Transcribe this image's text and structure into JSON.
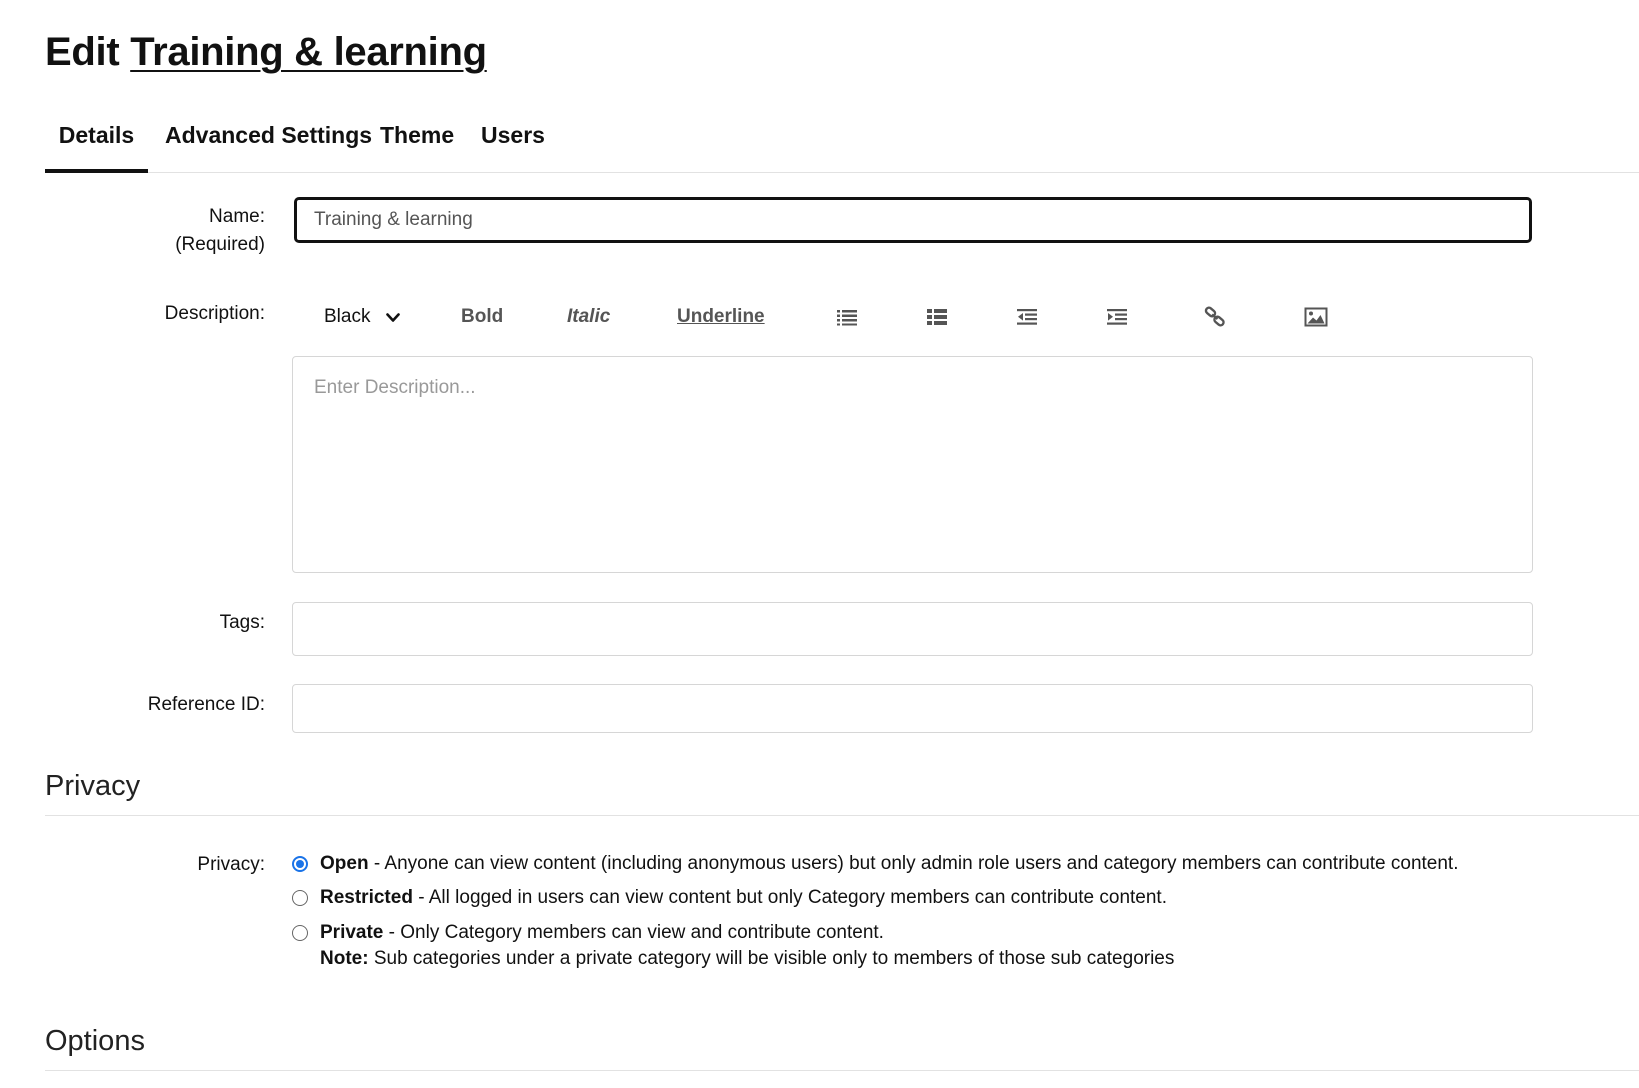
{
  "header": {
    "prefix": "Edit",
    "category_name": "Training & learning"
  },
  "tabs": [
    {
      "label": "Details",
      "active": true
    },
    {
      "label": "Advanced Settings",
      "active": false
    },
    {
      "label": "Theme",
      "active": false
    },
    {
      "label": "Users",
      "active": false
    }
  ],
  "form": {
    "name": {
      "label": "Name:",
      "required_label": "(Required)",
      "value": "Training & learning"
    },
    "description": {
      "label": "Description:",
      "placeholder": "Enter Description...",
      "toolbar": {
        "color": "Black",
        "bold": "Bold",
        "italic": "Italic",
        "underline": "Underline",
        "icons": [
          "bullet-list-icon",
          "numbered-list-icon",
          "outdent-icon",
          "indent-icon",
          "link-icon",
          "image-icon"
        ]
      }
    },
    "tags": {
      "label": "Tags:",
      "value": ""
    },
    "reference_id": {
      "label": "Reference ID:",
      "value": ""
    }
  },
  "privacy": {
    "section_title": "Privacy",
    "label": "Privacy:",
    "selected": "Open",
    "options": [
      {
        "title": "Open",
        "description": " - Anyone can view content (including anonymous users) but only admin role users and category members can contribute content."
      },
      {
        "title": "Restricted",
        "description": " - All logged in users can view content but only Category members can contribute content."
      },
      {
        "title": "Private",
        "description": " - Only Category members can view and contribute content."
      }
    ],
    "note_label": "Note:",
    "note_text": " Sub categories under a private category will be visible only to members of those sub categories"
  },
  "options": {
    "section_title": "Options"
  },
  "colors": {
    "accent": "#1a73e8",
    "text": "#111111",
    "border": "#d6d6d6"
  }
}
